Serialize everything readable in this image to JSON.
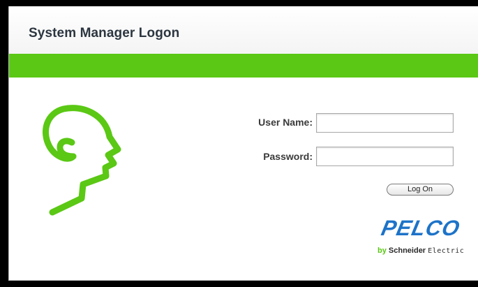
{
  "window": {
    "title": "System Manager Logon"
  },
  "form": {
    "username_label": "User Name:",
    "username_value": "",
    "password_label": "Password:",
    "password_value": "",
    "logon_label": "Log On"
  },
  "brand": {
    "name": "PELCO",
    "by": "by",
    "company": "Schneider",
    "company_suffix": "Electric"
  },
  "icons": {
    "head_logo": "head-profile-logo-icon"
  },
  "colors": {
    "accent_green": "#5ac814",
    "brand_blue": "#1d73c8",
    "title_text": "#2c3640"
  }
}
